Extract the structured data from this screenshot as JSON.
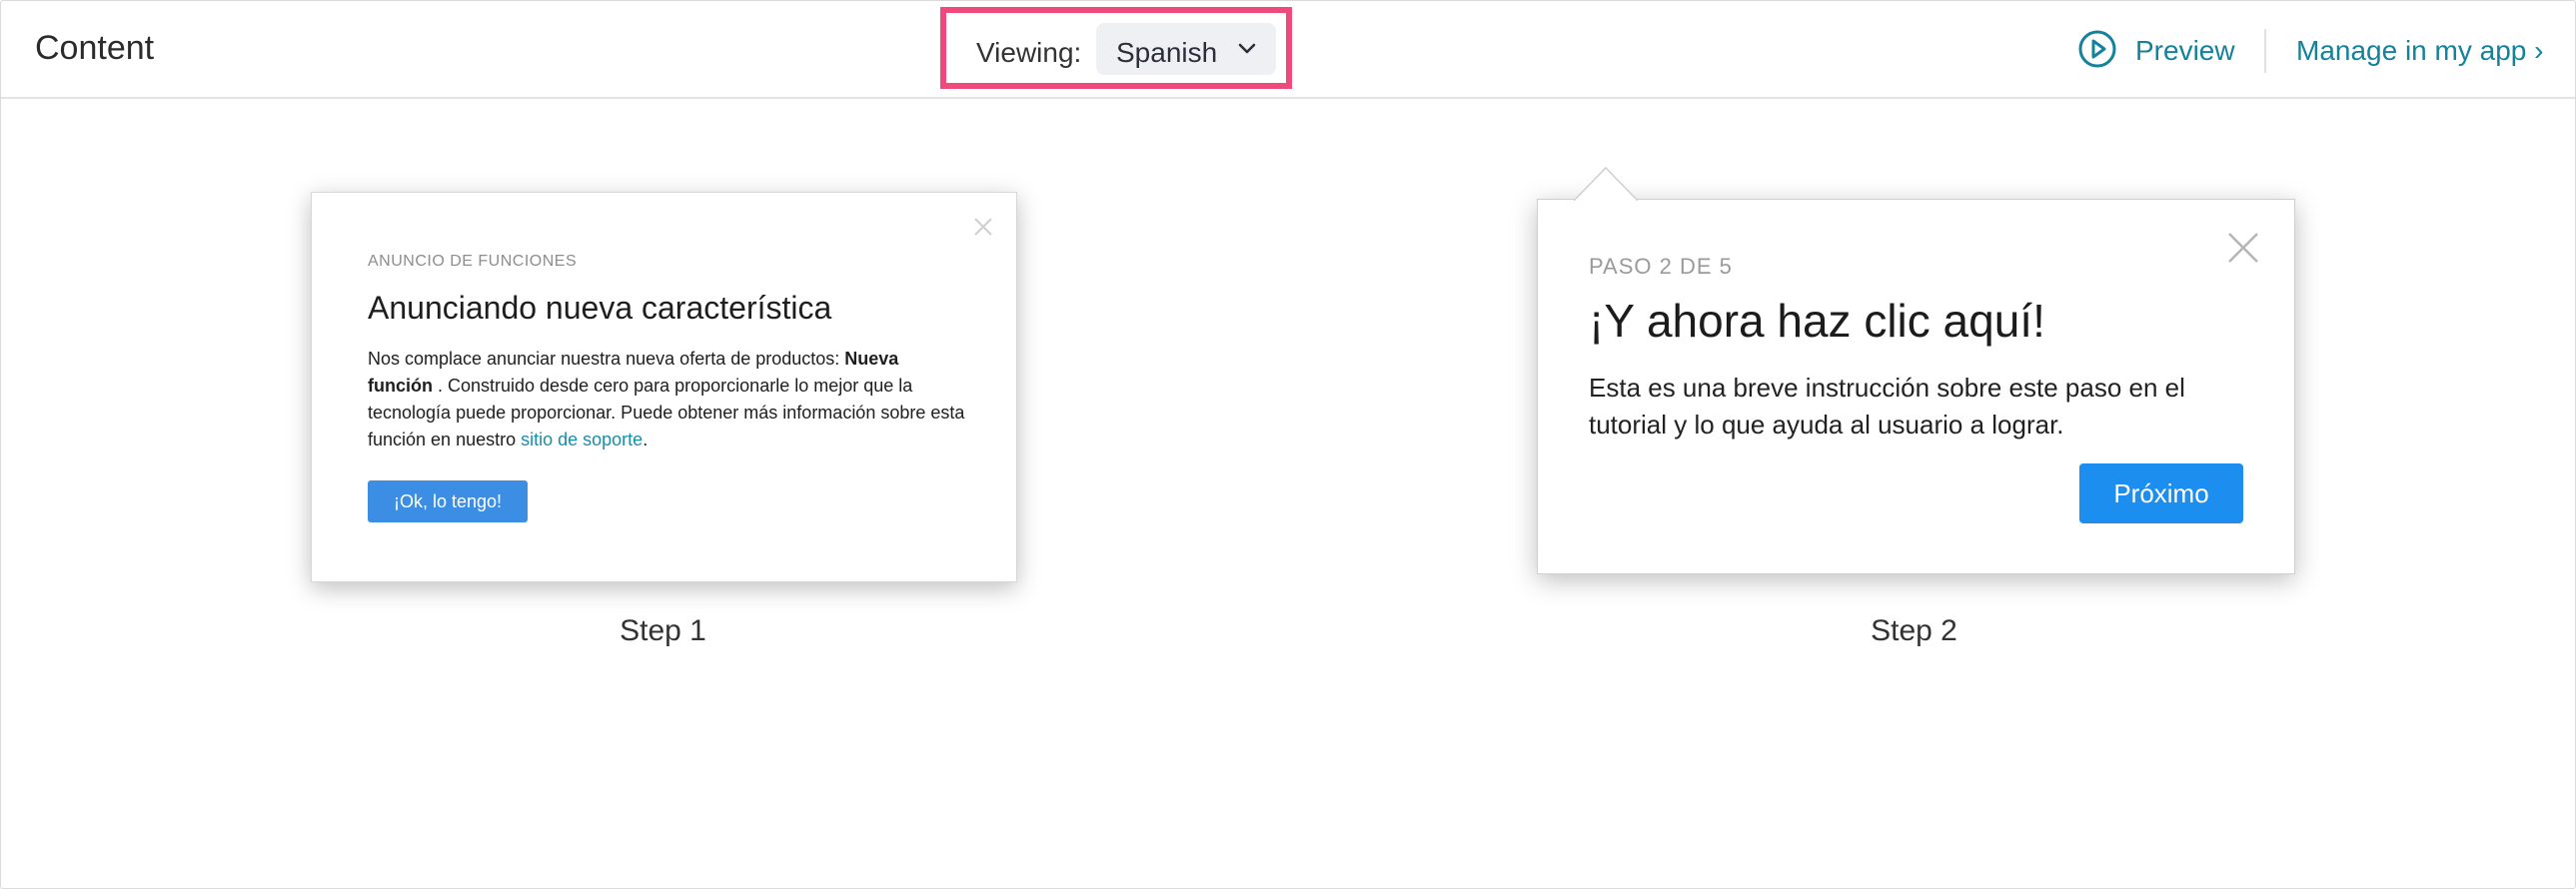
{
  "header": {
    "title": "Content",
    "viewing_label": "Viewing:",
    "language": "Spanish",
    "preview_label": "Preview",
    "manage_label": "Manage in my app ›"
  },
  "step1": {
    "eyebrow": "ANUNCIO DE FUNCIONES",
    "heading": "Anunciando nueva característica",
    "body_intro": "Nos complace anunciar nuestra nueva oferta de productos: ",
    "body_bold": "Nueva función",
    "body_mid": " . Construido desde cero para proporcionarle lo mejor que la tecnología puede proporcionar. Puede obtener más información sobre esta función en nuestro ",
    "body_link": "sitio de soporte",
    "body_end": ".",
    "button": "¡Ok, lo tengo!",
    "label": "Step 1"
  },
  "step2": {
    "eyebrow": "PASO 2 DE 5",
    "heading": "¡Y ahora haz clic aquí!",
    "body": "Esta es una breve instrucción sobre este paso en el tutorial y lo que ayuda al usuario a lograr.",
    "button": "Próximo",
    "label": "Step 2"
  },
  "colors": {
    "accent_link": "#14829b",
    "highlight_border": "#f04a7d",
    "step1_button": "#3c8ee5",
    "step2_button": "#1b8ef0"
  },
  "icons": {
    "preview": "play-circle-icon",
    "dropdown": "chevron-down-icon",
    "close": "close-icon"
  }
}
